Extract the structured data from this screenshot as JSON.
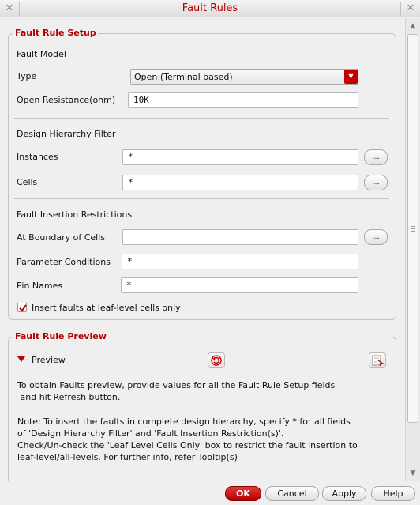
{
  "window": {
    "title": "Fault Rules"
  },
  "setup": {
    "group_title": "Fault Rule Setup",
    "fault_model_label": "Fault Model",
    "type_label": "Type",
    "type_value": "Open (Terminal based)",
    "open_resistance_label": "Open Resistance(ohm)",
    "open_resistance_value": "10K",
    "hierarchy_title": "Design Hierarchy Filter",
    "instances_label": "Instances",
    "instances_value": "*",
    "cells_label": "Cells",
    "cells_value": "*",
    "restrictions_title": "Fault Insertion Restrictions",
    "boundary_label": "At Boundary of Cells",
    "boundary_value": "",
    "param_label": "Parameter Conditions",
    "param_value": "*",
    "pin_label": "Pin Names",
    "pin_value": "*",
    "leaf_checkbox_label": "Insert faults at leaf-level cells only",
    "leaf_checked": true,
    "ellipsis": "..."
  },
  "preview": {
    "group_title": "Fault Rule Preview",
    "preview_label": "Preview",
    "info_line1": "To obtain Faults preview, provide values for all the Fault Rule Setup fields",
    "info_line2": " and hit Refresh button.",
    "note_line1": "Note: To insert the faults in complete design hierarchy, specify * for all fields",
    "note_line2": "of 'Design Hierarchy Filter' and 'Fault Insertion Restriction(s)'.",
    "note_line3": "Check/Un-check the 'Leaf Level Cells Only' box to restrict the fault insertion to",
    "note_line4": "leaf-level/all-levels. For further info, refer Tooltip(s)"
  },
  "buttons": {
    "ok": "OK",
    "cancel": "Cancel",
    "apply": "Apply",
    "help": "Help"
  },
  "colors": {
    "accent": "#b30000",
    "primary_button": "#c40000"
  }
}
